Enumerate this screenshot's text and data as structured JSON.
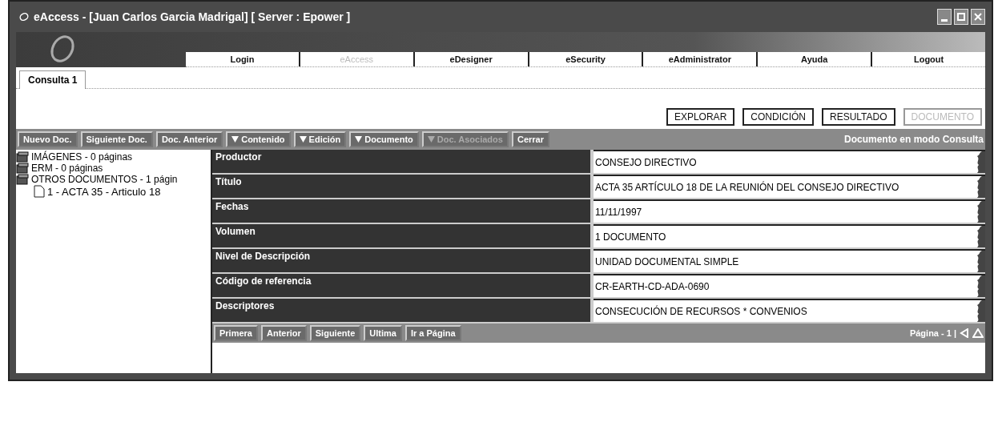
{
  "window": {
    "title": "eAccess - [Juan Carlos Garcia Madrigal] [ Server : Epower ]"
  },
  "app_tabs": [
    {
      "label": "Login",
      "disabled": false
    },
    {
      "label": "eAccess",
      "disabled": true
    },
    {
      "label": "eDesigner",
      "disabled": false
    },
    {
      "label": "eSecurity",
      "disabled": false
    },
    {
      "label": "eAdministrator",
      "disabled": false
    },
    {
      "label": "Ayuda",
      "disabled": false
    },
    {
      "label": "Logout",
      "disabled": false
    }
  ],
  "query_tabs": [
    {
      "label": "Consulta 1",
      "selected": true
    }
  ],
  "mode_buttons": [
    {
      "label": "EXPLORAR",
      "disabled": false
    },
    {
      "label": "CONDICIÓN",
      "disabled": false
    },
    {
      "label": "RESULTADO",
      "disabled": false
    },
    {
      "label": "DOCUMENTO",
      "disabled": true
    }
  ],
  "toolbar": {
    "buttons": [
      {
        "label": "Nuevo Doc.",
        "dropdown": false,
        "disabled": false
      },
      {
        "label": "Siguiente Doc.",
        "dropdown": false,
        "disabled": false
      },
      {
        "label": "Doc. Anterior",
        "dropdown": false,
        "disabled": false
      },
      {
        "label": "Contenido",
        "dropdown": true,
        "disabled": false
      },
      {
        "label": "Edición",
        "dropdown": true,
        "disabled": false
      },
      {
        "label": "Documento",
        "dropdown": true,
        "disabled": false
      },
      {
        "label": "Doc. Asociados",
        "dropdown": true,
        "disabled": true
      },
      {
        "label": "Cerrar",
        "dropdown": false,
        "disabled": false
      }
    ],
    "status": "Documento en modo Consulta"
  },
  "tree": [
    {
      "label": "IMÁGENES - 0 páginas",
      "kind": "folder"
    },
    {
      "label": "ERM - 0 páginas",
      "kind": "folder"
    },
    {
      "label": "OTROS DOCUMENTOS - 1 págin",
      "kind": "folder",
      "children": [
        {
          "label": "1 - ACTA 35 - Articulo 18",
          "kind": "file"
        }
      ]
    }
  ],
  "fields": [
    {
      "label": "Productor",
      "value": "CONSEJO DIRECTIVO"
    },
    {
      "label": "Título",
      "value": "ACTA 35 ARTÍCULO 18 DE LA REUNIÓN DEL CONSEJO DIRECTIVO"
    },
    {
      "label": "Fechas",
      "value": "11/11/1997"
    },
    {
      "label": "Volumen",
      "value": "1 DOCUMENTO"
    },
    {
      "label": "Nivel de Descripción",
      "value": "UNIDAD DOCUMENTAL SIMPLE"
    },
    {
      "label": "Código de referencia",
      "value": "CR-EARTH-CD-ADA-0690"
    },
    {
      "label": "Descriptores",
      "value": "CONSECUCIÓN DE RECURSOS * CONVENIOS"
    }
  ],
  "pager": {
    "buttons": [
      "Primera",
      "Anterior",
      "Siguiente",
      "Ultima",
      "Ir a Página"
    ],
    "page": "Página - 1 |"
  }
}
